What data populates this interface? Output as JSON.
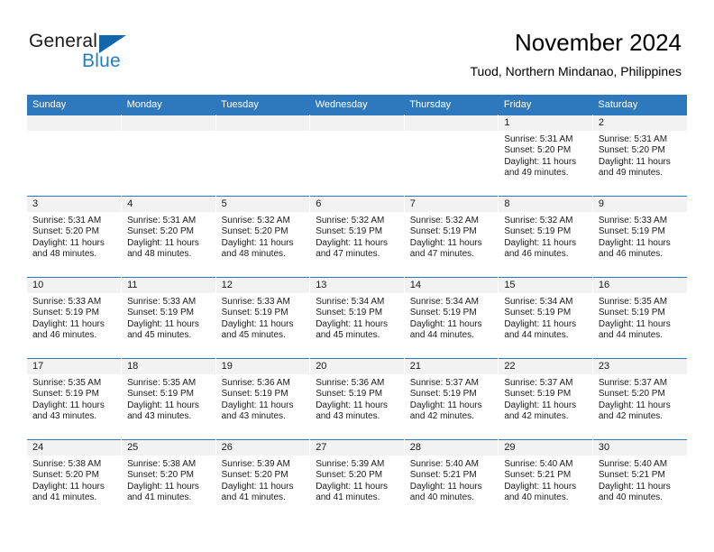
{
  "brand": {
    "name_part1": "General",
    "name_part2": "Blue",
    "accent_color": "#1f7fc4",
    "triangle_color": "#1266ad",
    "logo_icon": "blue-triangle-icon"
  },
  "header": {
    "title": "November 2024",
    "subtitle": "Tuod, Northern Mindanao, Philippines",
    "header_bg_color": "#2e79bd",
    "daynum_band_color": "#f2f2f2"
  },
  "weekday_headers": [
    "Sunday",
    "Monday",
    "Tuesday",
    "Wednesday",
    "Thursday",
    "Friday",
    "Saturday"
  ],
  "weeks": [
    [
      {
        "day": "",
        "sunrise": "",
        "sunset": "",
        "daylight_line1": "",
        "daylight_line2": "",
        "empty": true
      },
      {
        "day": "",
        "sunrise": "",
        "sunset": "",
        "daylight_line1": "",
        "daylight_line2": "",
        "empty": true
      },
      {
        "day": "",
        "sunrise": "",
        "sunset": "",
        "daylight_line1": "",
        "daylight_line2": "",
        "empty": true
      },
      {
        "day": "",
        "sunrise": "",
        "sunset": "",
        "daylight_line1": "",
        "daylight_line2": "",
        "empty": true
      },
      {
        "day": "",
        "sunrise": "",
        "sunset": "",
        "daylight_line1": "",
        "daylight_line2": "",
        "empty": true
      },
      {
        "day": "1",
        "sunrise": "Sunrise: 5:31 AM",
        "sunset": "Sunset: 5:20 PM",
        "daylight_line1": "Daylight: 11 hours",
        "daylight_line2": "and 49 minutes.",
        "empty": false
      },
      {
        "day": "2",
        "sunrise": "Sunrise: 5:31 AM",
        "sunset": "Sunset: 5:20 PM",
        "daylight_line1": "Daylight: 11 hours",
        "daylight_line2": "and 49 minutes.",
        "empty": false
      }
    ],
    [
      {
        "day": "3",
        "sunrise": "Sunrise: 5:31 AM",
        "sunset": "Sunset: 5:20 PM",
        "daylight_line1": "Daylight: 11 hours",
        "daylight_line2": "and 48 minutes.",
        "empty": false
      },
      {
        "day": "4",
        "sunrise": "Sunrise: 5:31 AM",
        "sunset": "Sunset: 5:20 PM",
        "daylight_line1": "Daylight: 11 hours",
        "daylight_line2": "and 48 minutes.",
        "empty": false
      },
      {
        "day": "5",
        "sunrise": "Sunrise: 5:32 AM",
        "sunset": "Sunset: 5:20 PM",
        "daylight_line1": "Daylight: 11 hours",
        "daylight_line2": "and 48 minutes.",
        "empty": false
      },
      {
        "day": "6",
        "sunrise": "Sunrise: 5:32 AM",
        "sunset": "Sunset: 5:19 PM",
        "daylight_line1": "Daylight: 11 hours",
        "daylight_line2": "and 47 minutes.",
        "empty": false
      },
      {
        "day": "7",
        "sunrise": "Sunrise: 5:32 AM",
        "sunset": "Sunset: 5:19 PM",
        "daylight_line1": "Daylight: 11 hours",
        "daylight_line2": "and 47 minutes.",
        "empty": false
      },
      {
        "day": "8",
        "sunrise": "Sunrise: 5:32 AM",
        "sunset": "Sunset: 5:19 PM",
        "daylight_line1": "Daylight: 11 hours",
        "daylight_line2": "and 46 minutes.",
        "empty": false
      },
      {
        "day": "9",
        "sunrise": "Sunrise: 5:33 AM",
        "sunset": "Sunset: 5:19 PM",
        "daylight_line1": "Daylight: 11 hours",
        "daylight_line2": "and 46 minutes.",
        "empty": false
      }
    ],
    [
      {
        "day": "10",
        "sunrise": "Sunrise: 5:33 AM",
        "sunset": "Sunset: 5:19 PM",
        "daylight_line1": "Daylight: 11 hours",
        "daylight_line2": "and 46 minutes.",
        "empty": false
      },
      {
        "day": "11",
        "sunrise": "Sunrise: 5:33 AM",
        "sunset": "Sunset: 5:19 PM",
        "daylight_line1": "Daylight: 11 hours",
        "daylight_line2": "and 45 minutes.",
        "empty": false
      },
      {
        "day": "12",
        "sunrise": "Sunrise: 5:33 AM",
        "sunset": "Sunset: 5:19 PM",
        "daylight_line1": "Daylight: 11 hours",
        "daylight_line2": "and 45 minutes.",
        "empty": false
      },
      {
        "day": "13",
        "sunrise": "Sunrise: 5:34 AM",
        "sunset": "Sunset: 5:19 PM",
        "daylight_line1": "Daylight: 11 hours",
        "daylight_line2": "and 45 minutes.",
        "empty": false
      },
      {
        "day": "14",
        "sunrise": "Sunrise: 5:34 AM",
        "sunset": "Sunset: 5:19 PM",
        "daylight_line1": "Daylight: 11 hours",
        "daylight_line2": "and 44 minutes.",
        "empty": false
      },
      {
        "day": "15",
        "sunrise": "Sunrise: 5:34 AM",
        "sunset": "Sunset: 5:19 PM",
        "daylight_line1": "Daylight: 11 hours",
        "daylight_line2": "and 44 minutes.",
        "empty": false
      },
      {
        "day": "16",
        "sunrise": "Sunrise: 5:35 AM",
        "sunset": "Sunset: 5:19 PM",
        "daylight_line1": "Daylight: 11 hours",
        "daylight_line2": "and 44 minutes.",
        "empty": false
      }
    ],
    [
      {
        "day": "17",
        "sunrise": "Sunrise: 5:35 AM",
        "sunset": "Sunset: 5:19 PM",
        "daylight_line1": "Daylight: 11 hours",
        "daylight_line2": "and 43 minutes.",
        "empty": false
      },
      {
        "day": "18",
        "sunrise": "Sunrise: 5:35 AM",
        "sunset": "Sunset: 5:19 PM",
        "daylight_line1": "Daylight: 11 hours",
        "daylight_line2": "and 43 minutes.",
        "empty": false
      },
      {
        "day": "19",
        "sunrise": "Sunrise: 5:36 AM",
        "sunset": "Sunset: 5:19 PM",
        "daylight_line1": "Daylight: 11 hours",
        "daylight_line2": "and 43 minutes.",
        "empty": false
      },
      {
        "day": "20",
        "sunrise": "Sunrise: 5:36 AM",
        "sunset": "Sunset: 5:19 PM",
        "daylight_line1": "Daylight: 11 hours",
        "daylight_line2": "and 43 minutes.",
        "empty": false
      },
      {
        "day": "21",
        "sunrise": "Sunrise: 5:37 AM",
        "sunset": "Sunset: 5:19 PM",
        "daylight_line1": "Daylight: 11 hours",
        "daylight_line2": "and 42 minutes.",
        "empty": false
      },
      {
        "day": "22",
        "sunrise": "Sunrise: 5:37 AM",
        "sunset": "Sunset: 5:19 PM",
        "daylight_line1": "Daylight: 11 hours",
        "daylight_line2": "and 42 minutes.",
        "empty": false
      },
      {
        "day": "23",
        "sunrise": "Sunrise: 5:37 AM",
        "sunset": "Sunset: 5:20 PM",
        "daylight_line1": "Daylight: 11 hours",
        "daylight_line2": "and 42 minutes.",
        "empty": false
      }
    ],
    [
      {
        "day": "24",
        "sunrise": "Sunrise: 5:38 AM",
        "sunset": "Sunset: 5:20 PM",
        "daylight_line1": "Daylight: 11 hours",
        "daylight_line2": "and 41 minutes.",
        "empty": false
      },
      {
        "day": "25",
        "sunrise": "Sunrise: 5:38 AM",
        "sunset": "Sunset: 5:20 PM",
        "daylight_line1": "Daylight: 11 hours",
        "daylight_line2": "and 41 minutes.",
        "empty": false
      },
      {
        "day": "26",
        "sunrise": "Sunrise: 5:39 AM",
        "sunset": "Sunset: 5:20 PM",
        "daylight_line1": "Daylight: 11 hours",
        "daylight_line2": "and 41 minutes.",
        "empty": false
      },
      {
        "day": "27",
        "sunrise": "Sunrise: 5:39 AM",
        "sunset": "Sunset: 5:20 PM",
        "daylight_line1": "Daylight: 11 hours",
        "daylight_line2": "and 41 minutes.",
        "empty": false
      },
      {
        "day": "28",
        "sunrise": "Sunrise: 5:40 AM",
        "sunset": "Sunset: 5:21 PM",
        "daylight_line1": "Daylight: 11 hours",
        "daylight_line2": "and 40 minutes.",
        "empty": false
      },
      {
        "day": "29",
        "sunrise": "Sunrise: 5:40 AM",
        "sunset": "Sunset: 5:21 PM",
        "daylight_line1": "Daylight: 11 hours",
        "daylight_line2": "and 40 minutes.",
        "empty": false
      },
      {
        "day": "30",
        "sunrise": "Sunrise: 5:40 AM",
        "sunset": "Sunset: 5:21 PM",
        "daylight_line1": "Daylight: 11 hours",
        "daylight_line2": "and 40 minutes.",
        "empty": false
      }
    ]
  ]
}
